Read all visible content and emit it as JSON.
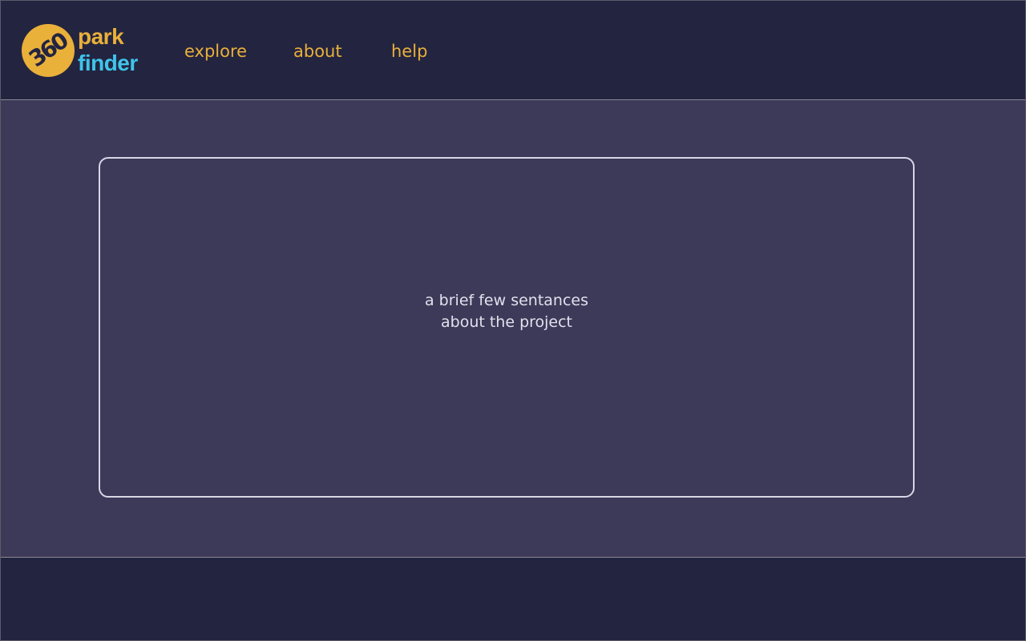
{
  "brand": {
    "badge_text": "360",
    "word_1": "park",
    "word_2": "finder",
    "colors": {
      "badge": "#e9b03a",
      "word_1": "#e9b03a",
      "word_2": "#3fc4ea"
    }
  },
  "nav": {
    "items": [
      {
        "label": "explore"
      },
      {
        "label": "about"
      },
      {
        "label": "help"
      }
    ]
  },
  "main": {
    "card": {
      "line_1": "a brief few sentances",
      "line_2": "about the project"
    }
  },
  "colors": {
    "header_bg": "#232440",
    "main_bg": "#3d3958",
    "nav_link": "#e9b03a",
    "card_border": "#d8d6e6",
    "card_text": "#e2e0ee"
  }
}
